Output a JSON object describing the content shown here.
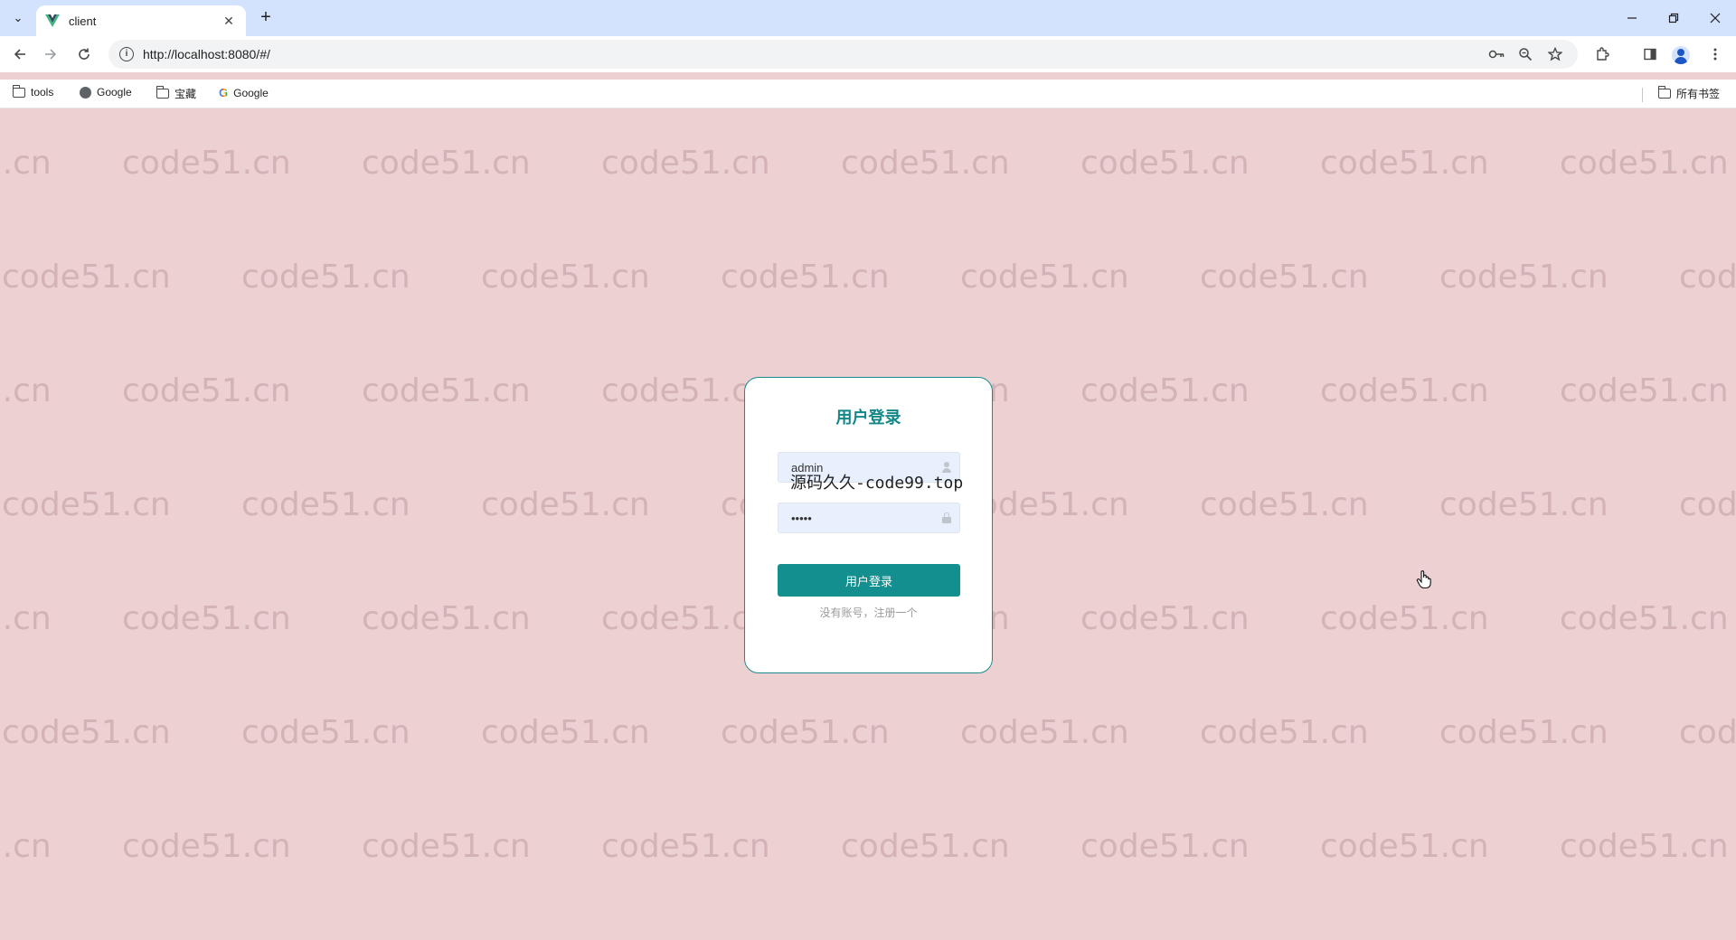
{
  "browser": {
    "tab": {
      "title": "client",
      "close_glyph": "✕"
    },
    "new_tab_glyph": "+",
    "url": "http://localhost:8080/#/",
    "bookmarks": [
      {
        "label": "tools",
        "icon": "folder-icon"
      },
      {
        "label": "Google",
        "icon": "globe-icon"
      },
      {
        "label": "宝藏",
        "icon": "folder-icon"
      },
      {
        "label": "Google",
        "icon": "google-icon"
      }
    ],
    "all_bookmarks_label": "所有书签"
  },
  "login": {
    "title": "用户登录",
    "username_value": "admin",
    "password_value": "•••••",
    "submit_label": "用户登录",
    "register_link": "没有账号，注册一个"
  },
  "overlay": {
    "text": "源码久久-code99.top"
  },
  "watermark": {
    "text": "code51.cn"
  },
  "colors": {
    "accent": "#138f8f",
    "page_bg": "#ecd0d2",
    "tab_bar": "#d3e3fd"
  }
}
